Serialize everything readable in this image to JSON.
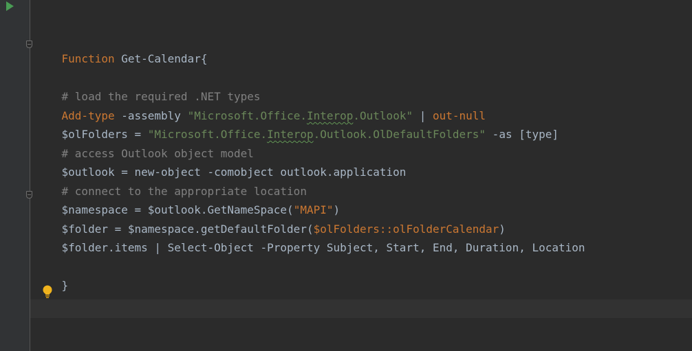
{
  "editor": {
    "lines": {
      "l1": {
        "keyword": "Function",
        "rest": " Get-Calendar{"
      },
      "l2": {
        "comment": "# load the required .NET types"
      },
      "l3": {
        "cmd": "Add-type",
        "param": " -assembly ",
        "str_a": "\"Microsoft.Office.",
        "str_b": "Interop",
        "str_c": ".Outlook\"",
        "pipe": " | ",
        "cmd2": "out-null"
      },
      "l4": {
        "var": "$olFolders",
        "eq": " = ",
        "str_a": "\"Microsoft.Office.",
        "str_b": "Interop",
        "str_c": ".Outlook.OlDefaultFolders\"",
        "rest": " -as [type]"
      },
      "l5": {
        "comment": "# access Outlook object model"
      },
      "l6": {
        "text": "$outlook = new-object -comobject outlook.application"
      },
      "l7": {
        "comment": "# connect to the appropriate location"
      },
      "l8": {
        "text_a": "$namespace = $outlook.GetNameSpace(",
        "str": "\"MAPI\"",
        "text_b": ")"
      },
      "l9": {
        "text_a": "$folder = $namespace.getDefaultFolder(",
        "orange": "$olFolders::olFolderCalendar",
        "text_b": ")"
      },
      "l10": {
        "text": "$folder.items | Select-Object -Property Subject, Start, End, Duration, Location"
      },
      "l11": {
        "text": "}"
      }
    }
  },
  "icons": {
    "run": "run-gutter-icon",
    "fold": "fold-marker-icon",
    "intention": "lightbulb-icon"
  },
  "colors": {
    "background": "#2b2b2b",
    "keyword": "#cc7832",
    "string": "#6a8759",
    "comment": "#808080",
    "text": "#a9b7c6",
    "run_icon": "#499c54",
    "bulb": "#f0b31d"
  }
}
